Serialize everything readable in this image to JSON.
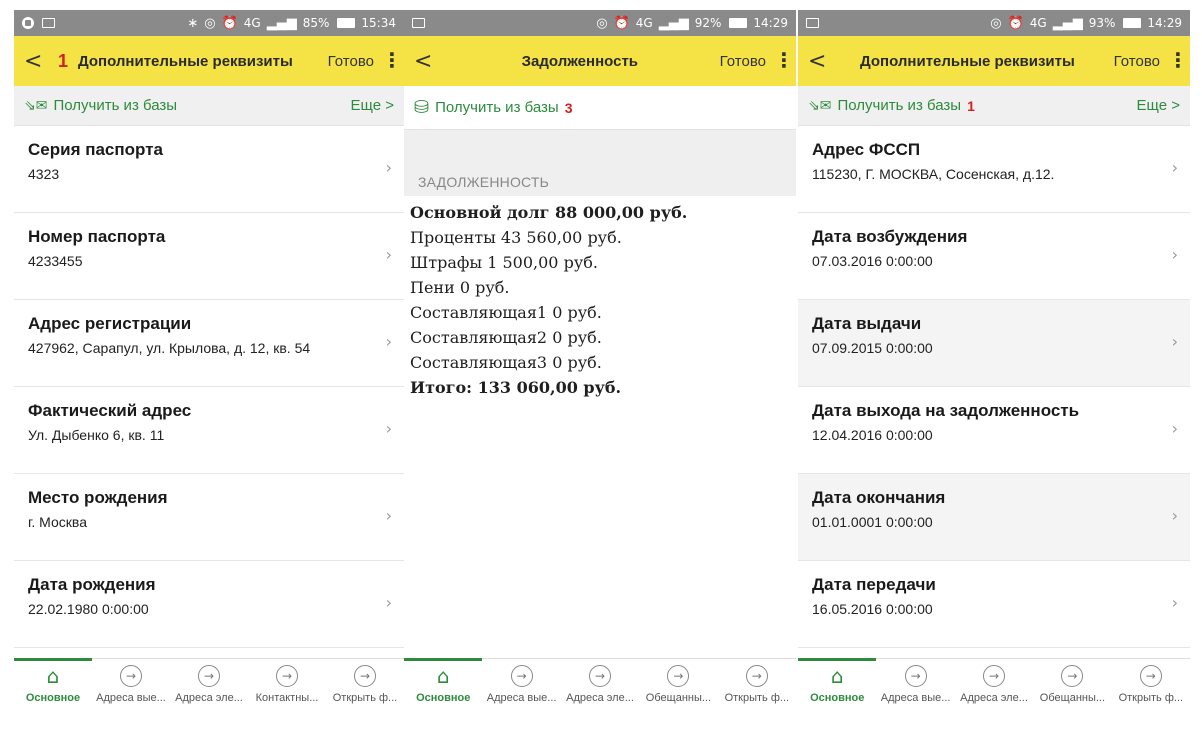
{
  "screens": [
    {
      "status": {
        "battery": "85%",
        "time": "15:34",
        "network": "4G"
      },
      "header": {
        "back": "<",
        "badge": "1",
        "title": "Дополнительные реквизиты",
        "done": "Готово"
      },
      "action": {
        "label": "Получить из базы",
        "badge": "",
        "more": "Еще >"
      },
      "items": [
        {
          "label": "Серия паспорта",
          "value": "4323"
        },
        {
          "label": "Номер паспорта",
          "value": "4233455"
        },
        {
          "label": "Адрес регистрации",
          "value": "427962, Сарапул, ул. Крылова, д. 12, кв. 54"
        },
        {
          "label": "Фактический адрес",
          "value": "Ул. Дыбенко 6, кв. 11"
        },
        {
          "label": "Место рождения",
          "value": "г. Москва"
        },
        {
          "label": "Дата рождения",
          "value": "22.02.1980 0:00:00"
        }
      ],
      "tabs": [
        "Основное",
        "Адреса вые...",
        "Адреса эле...",
        "Контактны...",
        "Открыть ф..."
      ]
    },
    {
      "status": {
        "battery": "92%",
        "time": "14:29",
        "network": "4G"
      },
      "header": {
        "back": "<",
        "title": "Задолженность",
        "done": "Готово"
      },
      "action": {
        "label": "Получить из базы",
        "badge": "3"
      },
      "section_title": "ЗАДОЛЖЕННОСТЬ",
      "debt_lines": [
        "Основной долг 88 000,00 руб.",
        "Проценты 43 560,00 руб.",
        "Штрафы 1 500,00 руб.",
        "Пени 0 руб.",
        "Составляющая1 0 руб.",
        "Составляющая2 0 руб.",
        "Составляющая3 0 руб.",
        "Итого: 133 060,00 руб."
      ],
      "tabs": [
        "Основное",
        "Адреса вые...",
        "Адреса эле...",
        "Обещанны...",
        "Открыть ф..."
      ]
    },
    {
      "status": {
        "battery": "93%",
        "time": "14:29",
        "network": "4G"
      },
      "header": {
        "back": "<",
        "title": "Дополнительные реквизиты",
        "done": "Готово"
      },
      "action": {
        "label": "Получить из базы",
        "badge": "1",
        "more": "Еще >"
      },
      "items": [
        {
          "label": "Адрес ФССП",
          "value": "115230, Г. МОСКВА, Сосенская, д.12."
        },
        {
          "label": "Дата возбуждения",
          "value": "07.03.2016 0:00:00"
        },
        {
          "label": "Дата выдачи",
          "value": "07.09.2015 0:00:00"
        },
        {
          "label": "Дата выхода на задолженность",
          "value": "12.04.2016 0:00:00"
        },
        {
          "label": "Дата окончания",
          "value": "01.01.0001 0:00:00"
        },
        {
          "label": "Дата передачи",
          "value": "16.05.2016 0:00:00"
        }
      ],
      "tabs": [
        "Основное",
        "Адреса вые...",
        "Адреса эле...",
        "Обещанны...",
        "Открыть ф..."
      ]
    }
  ],
  "colors": {
    "header_yellow": "#f5e346",
    "accent_green": "#2e8b3e",
    "badge_red": "#d42020",
    "status_gray": "#8a8a8a"
  },
  "icons": {
    "back": "chevron-left-icon",
    "menu": "kebab-menu-icon",
    "home": "home-icon",
    "tab": "arrow-right-circle-icon",
    "chevron": "chevron-right-icon"
  }
}
